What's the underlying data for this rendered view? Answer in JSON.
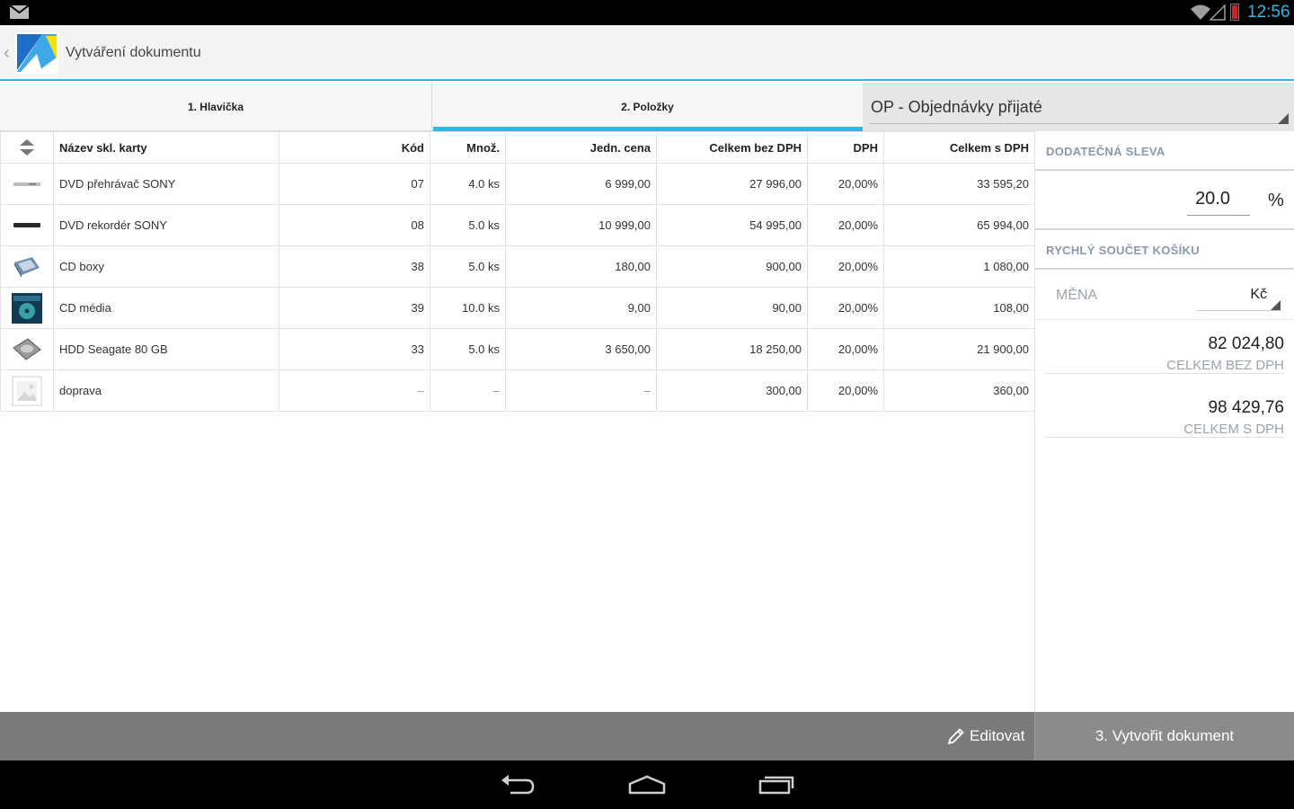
{
  "status": {
    "time": "12:56"
  },
  "app": {
    "title": "Vytváření dokumentu"
  },
  "tabs": [
    {
      "label": "1. Hlavička",
      "active": false
    },
    {
      "label": "2. Položky",
      "active": true
    }
  ],
  "doc_type": {
    "selected": "OP - Objednávky přijaté"
  },
  "table": {
    "columns": [
      "Název skl. karty",
      "Kód",
      "Množ.",
      "Jedn. cena",
      "Celkem bez DPH",
      "DPH",
      "Celkem s DPH"
    ],
    "rows": [
      {
        "thumb": "dvd-player-thumbnail",
        "name": "DVD přehrávač SONY",
        "code": "07",
        "qty": "4.0 ks",
        "unit_price": "6 999,00",
        "total_ex": "27 996,00",
        "vat": "20,00%",
        "total_inc": "33 595,20"
      },
      {
        "thumb": "dvd-recorder-thumbnail",
        "name": "DVD rekordér SONY",
        "code": "08",
        "qty": "5.0 ks",
        "unit_price": "10 999,00",
        "total_ex": "54 995,00",
        "vat": "20,00%",
        "total_inc": "65 994,00"
      },
      {
        "thumb": "cd-boxes-thumbnail",
        "name": "CD boxy",
        "code": "38",
        "qty": "5.0 ks",
        "unit_price": "180,00",
        "total_ex": "900,00",
        "vat": "20,00%",
        "total_inc": "1 080,00"
      },
      {
        "thumb": "cd-media-thumbnail",
        "name": "CD média",
        "code": "39",
        "qty": "10.0 ks",
        "unit_price": "9,00",
        "total_ex": "90,00",
        "vat": "20,00%",
        "total_inc": "108,00"
      },
      {
        "thumb": "hdd-thumbnail",
        "name": "HDD Seagate 80 GB",
        "code": "33",
        "qty": "5.0 ks",
        "unit_price": "3 650,00",
        "total_ex": "18 250,00",
        "vat": "20,00%",
        "total_inc": "21 900,00"
      },
      {
        "thumb": "image-placeholder-icon",
        "name": "doprava",
        "code": "–",
        "qty": "–",
        "unit_price": "–",
        "total_ex": "300,00",
        "vat": "20,00%",
        "total_inc": "360,00"
      }
    ]
  },
  "side": {
    "discount_header": "DODATEČNÁ SLEVA",
    "discount_value": "20.0",
    "discount_unit": "%",
    "quick_sum_header": "RYCHLÝ SOUČET KOŠÍKU",
    "currency_label": "MĚNA",
    "currency_value": "Kč",
    "total_ex_vat": "82 024,80",
    "total_ex_vat_label": "CELKEM BEZ DPH",
    "total_inc_vat": "98 429,76",
    "total_inc_vat_label": "CELKEM S DPH"
  },
  "bottom": {
    "edit_label": "Editovat",
    "create_label": "3. Vytvořit dokument"
  },
  "colors": {
    "accent": "#33b5e5",
    "bottombar": "#7a7a7a",
    "header_text": "#8a99ad"
  }
}
